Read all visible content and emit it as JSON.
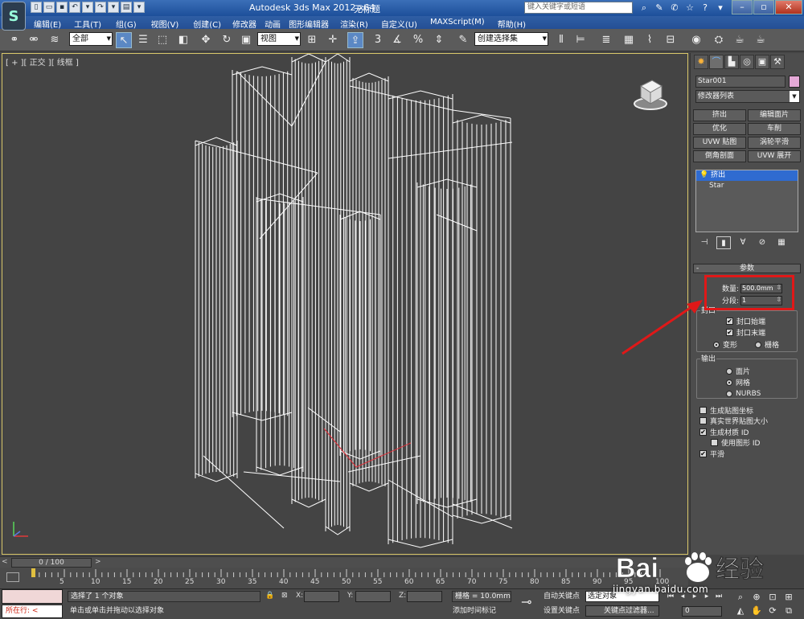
{
  "titlebar": {
    "app_title": "Autodesk 3ds Max  2012 x64",
    "doc_title": "无标题",
    "search_placeholder": "键入关键字或短语",
    "logo_glyph": "S"
  },
  "menu": [
    "编辑(E)",
    "工具(T)",
    "组(G)",
    "视图(V)",
    "创建(C)",
    "修改器",
    "动画",
    "图形编辑器",
    "渲染(R)",
    "自定义(U)",
    "MAXScript(M)",
    "帮助(H)"
  ],
  "toolbar": {
    "selection_filter": "全部",
    "ref_coord": "视图",
    "named_selection": "创建选择集"
  },
  "viewport": {
    "label": "[ + ][ 正交 ][ 线框 ]",
    "wire_color": "#ffffff",
    "pivot_color": "#e0303a"
  },
  "command_panel": {
    "object_name": "Star001",
    "object_color": "#e5a9d7",
    "modifier_list": "修改器列表",
    "modifier_buttons": [
      "挤出",
      "编辑面片",
      "优化",
      "车削",
      "UVW 贴图",
      "涡轮平滑",
      "倒角剖面",
      "UVW 展开"
    ],
    "stack": [
      {
        "label": "挤出",
        "selected": true
      },
      {
        "label": "Star",
        "selected": false
      }
    ],
    "rollout_title": "参数",
    "amount_label": "数量:",
    "amount_value": "500.0mm",
    "segments_label": "分段:",
    "segments_value": "1",
    "capping_title": "封口",
    "cap_start": "封口始端",
    "cap_end": "封口末端",
    "morph": "变形",
    "grid": "栅格",
    "output_title": "输出",
    "out_patch": "面片",
    "out_mesh": "网格",
    "out_nurbs": "NURBS",
    "gen_mapping": "生成贴图坐标",
    "real_world": "真实世界贴图大小",
    "gen_matid": "生成材质 ID",
    "use_shape_id": "使用图形 ID",
    "smooth": "平滑"
  },
  "timeline": {
    "frame_display": "0 / 100",
    "ticks": [
      "5",
      "10",
      "15",
      "20",
      "25",
      "30",
      "35",
      "40",
      "45",
      "50",
      "55",
      "60",
      "65",
      "70",
      "75",
      "80",
      "85",
      "90",
      "95",
      "100"
    ]
  },
  "status": {
    "script_line": "所在行:",
    "selection": "选择了 1 个对象",
    "prompt": "单击或单击并拖动以选择对象",
    "x_label": "X:",
    "y_label": "Y:",
    "z_label": "Z:",
    "grid": "栅格 = 10.0mm",
    "add_time_tag": "添加时间标记",
    "auto_key": "自动关键点",
    "set_key": "设置关键点",
    "selected_dd": "选定对象",
    "key_filters": "关键点过滤器...",
    "frame": "0"
  },
  "watermark": {
    "brand": "Bai",
    "brand2": "经验",
    "url": "jingyan.baidu.com"
  },
  "highlight_color": "#e01818"
}
